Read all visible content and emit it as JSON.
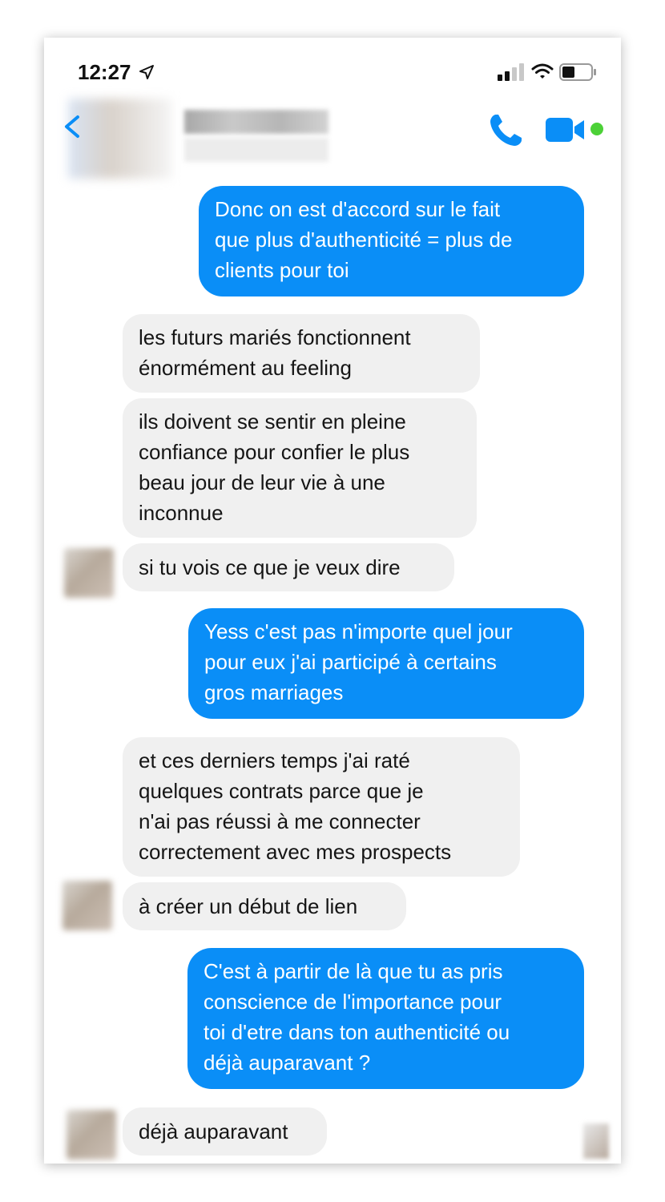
{
  "status_bar": {
    "time": "12:27",
    "icons": [
      "location-arrow-icon",
      "cellular-signal-icon",
      "wifi-icon",
      "battery-icon"
    ]
  },
  "header": {
    "back_icon": "chevron-left-icon",
    "contact_name_blurred": true,
    "actions": [
      "phone-icon",
      "video-camera-icon"
    ],
    "online_indicator_color": "#4cd137"
  },
  "colors": {
    "outgoing_bubble": "#0a8ef7",
    "incoming_bubble": "#f0f0f0",
    "accent": "#0a8ef7"
  },
  "messages": [
    {
      "direction": "outgoing",
      "text": "Donc on est d'accord sur le fait\nque plus d'authenticité = plus de\nclients pour toi"
    },
    {
      "direction": "incoming",
      "text": "les futurs mariés fonctionnent\nénormément au feeling"
    },
    {
      "direction": "incoming",
      "text": "ils doivent se sentir en pleine\nconfiance pour confier le plus\nbeau jour de leur vie à une\ninconnue"
    },
    {
      "direction": "incoming",
      "text": "si tu vois ce que je veux dire"
    },
    {
      "direction": "outgoing",
      "text": "Yess c'est pas n'importe quel jour\npour eux j'ai participé à certains\ngros marriages"
    },
    {
      "direction": "incoming",
      "text": "et ces derniers temps j'ai raté\nquelques contrats parce que je\nn'ai pas réussi à me connecter\ncorrectement avec mes prospects"
    },
    {
      "direction": "incoming",
      "text": "à créer un début de lien"
    },
    {
      "direction": "outgoing",
      "text": "C'est à partir de là que tu as pris\nconscience de l'importance pour\ntoi d'etre dans ton authenticité ou\ndéjà auparavant ?"
    },
    {
      "direction": "incoming",
      "text": "déjà auparavant"
    }
  ]
}
